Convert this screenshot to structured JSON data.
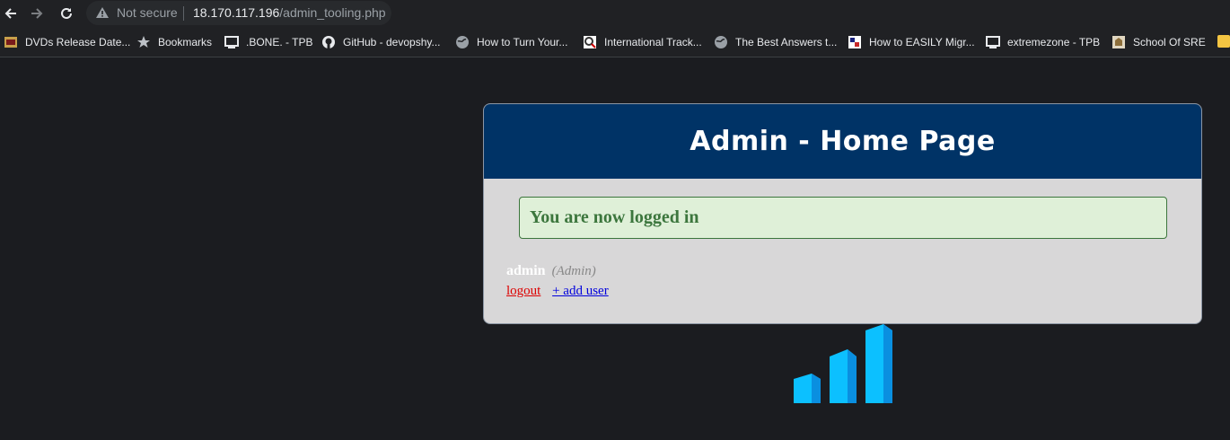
{
  "browser": {
    "security_label": "Not secure",
    "url_host": "18.170.117.196",
    "url_path": "/admin_tooling.php"
  },
  "bookmarks": [
    {
      "label": "DVDs Release Date...",
      "icon": "dvd-favicon"
    },
    {
      "label": "Bookmarks",
      "icon": "star-icon"
    },
    {
      "label": ".BONE. - TPB",
      "icon": "tpb-favicon"
    },
    {
      "label": "GitHub - devopshy...",
      "icon": "github-icon"
    },
    {
      "label": "How to Turn Your...",
      "icon": "globe-icon"
    },
    {
      "label": "International Track...",
      "icon": "tracking-favicon"
    },
    {
      "label": "The Best Answers t...",
      "icon": "globe-icon"
    },
    {
      "label": "How to EASILY Migr...",
      "icon": "migrate-favicon"
    },
    {
      "label": "extremezone - TPB",
      "icon": "tpb-favicon"
    },
    {
      "label": "School Of SRE",
      "icon": "school-favicon"
    }
  ],
  "page": {
    "title": "Admin - Home Page",
    "success_message": "You are now logged in",
    "username": "admin",
    "role": "(Admin)",
    "logout_label": "logout",
    "add_user_label": "+ add user"
  },
  "colors": {
    "header_bg": "#003366",
    "card_bg": "#d8d7d8",
    "success_text": "#3c763d",
    "success_bg": "#dff0d8",
    "logout_link": "#dd0000",
    "add_user_link": "#0000dd",
    "logo_blue": "#00a2ff"
  }
}
